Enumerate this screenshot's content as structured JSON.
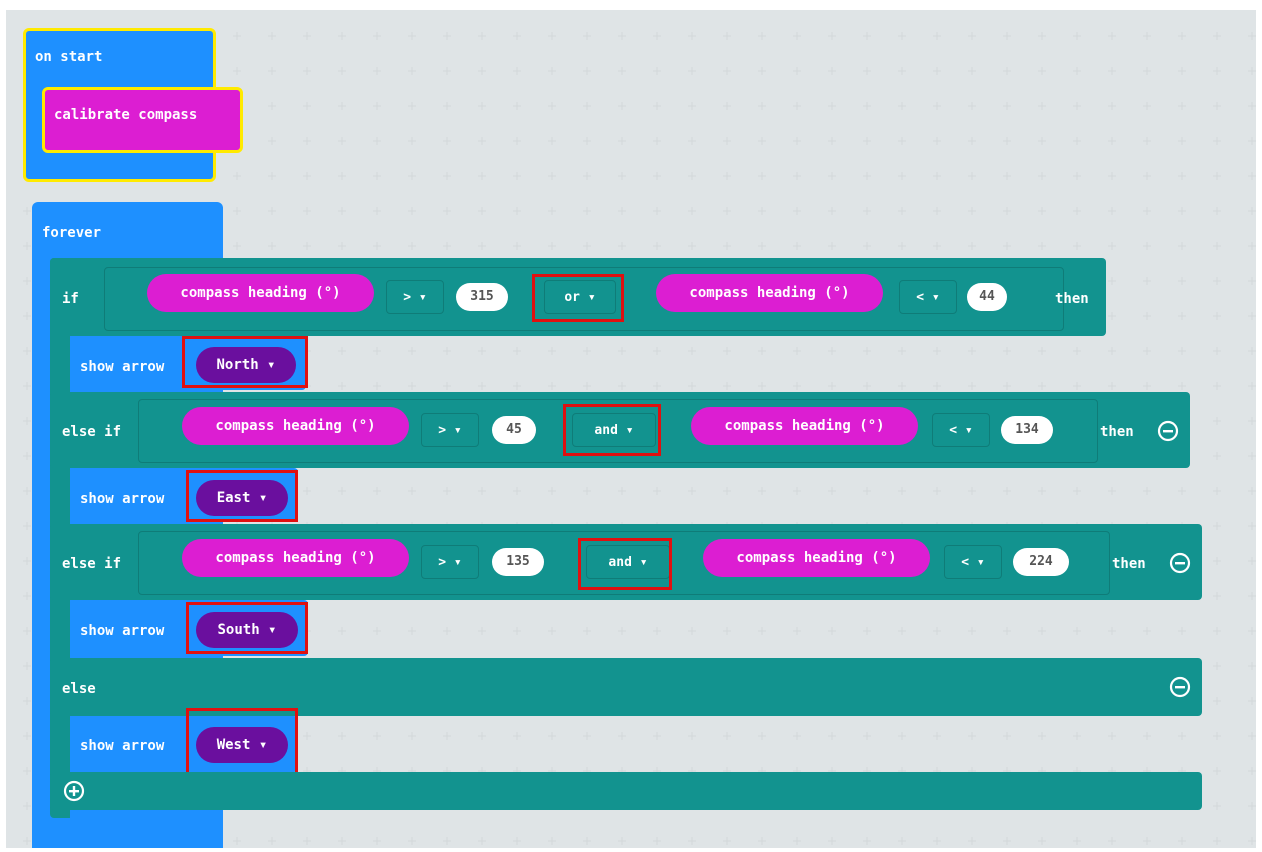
{
  "on_start": {
    "label": "on start",
    "calibrate": "calibrate compass"
  },
  "forever": {
    "label": "forever"
  },
  "branches": {
    "if": {
      "keyword": "if",
      "sensor": "compass heading (°)",
      "op1": "> ▾",
      "val1": "315",
      "logic": "or ▾",
      "sensor2": "compass heading (°)",
      "op2": "< ▾",
      "val2": "44",
      "then": "then",
      "action": "show arrow",
      "direction": "North ▾"
    },
    "elseif1": {
      "keyword": "else if",
      "sensor": "compass heading (°)",
      "op1": "> ▾",
      "val1": "45",
      "logic": "and ▾",
      "sensor2": "compass heading (°)",
      "op2": "< ▾",
      "val2": "134",
      "then": "then",
      "action": "show arrow",
      "direction": "East ▾"
    },
    "elseif2": {
      "keyword": "else if",
      "sensor": "compass heading (°)",
      "op1": "> ▾",
      "val1": "135",
      "logic": "and ▾",
      "sensor2": "compass heading (°)",
      "op2": "< ▾",
      "val2": "224",
      "then": "then",
      "action": "show arrow",
      "direction": "South ▾"
    },
    "else": {
      "keyword": "else",
      "action": "show arrow",
      "direction": "West ▾"
    }
  },
  "colors": {
    "events": "#1e90ff",
    "logic": "#12938f",
    "input": "#dc1ed2",
    "basic_dropdown": "#6a0f9e",
    "highlight": "#e01010",
    "selected": "#ffea00"
  },
  "icons": [
    "minus-circle-icon",
    "plus-circle-icon",
    "dropdown-caret-icon"
  ]
}
